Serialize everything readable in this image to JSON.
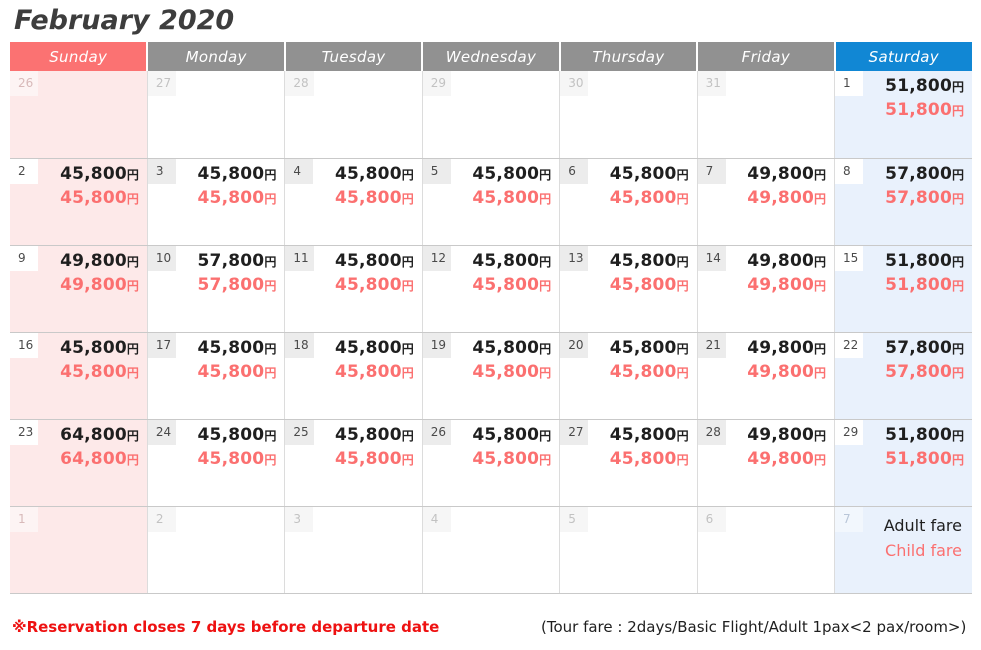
{
  "header": {
    "title": "February 2020"
  },
  "calendar": {
    "weekday_headers": [
      {
        "label": "Sunday",
        "kind": "sun"
      },
      {
        "label": "Monday",
        "kind": "weekday"
      },
      {
        "label": "Tuesday",
        "kind": "weekday"
      },
      {
        "label": "Wednesday",
        "kind": "weekday"
      },
      {
        "label": "Thursday",
        "kind": "weekday"
      },
      {
        "label": "Friday",
        "kind": "weekday"
      },
      {
        "label": "Saturday",
        "kind": "sat"
      }
    ],
    "currency_suffix": "円",
    "colors": {
      "sunday_header": "#fb7272",
      "weekday_header": "#919191",
      "saturday_header": "#1187d4",
      "sunday_cell": "#fde9e9",
      "saturday_cell": "#e9f1fc",
      "adult_fare_text": "#1f1f1f",
      "child_fare_text": "#fb7070",
      "note_text": "#ee1111"
    },
    "weeks": [
      [
        {
          "day": "26",
          "in_month": false,
          "col": "sun",
          "adult": "",
          "child": ""
        },
        {
          "day": "27",
          "in_month": false,
          "col": "weekday",
          "adult": "",
          "child": ""
        },
        {
          "day": "28",
          "in_month": false,
          "col": "weekday",
          "adult": "",
          "child": ""
        },
        {
          "day": "29",
          "in_month": false,
          "col": "weekday",
          "adult": "",
          "child": ""
        },
        {
          "day": "30",
          "in_month": false,
          "col": "weekday",
          "adult": "",
          "child": ""
        },
        {
          "day": "31",
          "in_month": false,
          "col": "weekday",
          "adult": "",
          "child": ""
        },
        {
          "day": "1",
          "in_month": true,
          "col": "sat",
          "adult": "51,800",
          "child": "51,800"
        }
      ],
      [
        {
          "day": "2",
          "in_month": true,
          "col": "sun",
          "adult": "45,800",
          "child": "45,800"
        },
        {
          "day": "3",
          "in_month": true,
          "col": "weekday",
          "adult": "45,800",
          "child": "45,800"
        },
        {
          "day": "4",
          "in_month": true,
          "col": "weekday",
          "adult": "45,800",
          "child": "45,800"
        },
        {
          "day": "5",
          "in_month": true,
          "col": "weekday",
          "adult": "45,800",
          "child": "45,800"
        },
        {
          "day": "6",
          "in_month": true,
          "col": "weekday",
          "adult": "45,800",
          "child": "45,800"
        },
        {
          "day": "7",
          "in_month": true,
          "col": "weekday",
          "adult": "49,800",
          "child": "49,800"
        },
        {
          "day": "8",
          "in_month": true,
          "col": "sat",
          "adult": "57,800",
          "child": "57,800"
        }
      ],
      [
        {
          "day": "9",
          "in_month": true,
          "col": "sun",
          "adult": "49,800",
          "child": "49,800"
        },
        {
          "day": "10",
          "in_month": true,
          "col": "weekday",
          "adult": "57,800",
          "child": "57,800"
        },
        {
          "day": "11",
          "in_month": true,
          "col": "weekday",
          "adult": "45,800",
          "child": "45,800"
        },
        {
          "day": "12",
          "in_month": true,
          "col": "weekday",
          "adult": "45,800",
          "child": "45,800"
        },
        {
          "day": "13",
          "in_month": true,
          "col": "weekday",
          "adult": "45,800",
          "child": "45,800"
        },
        {
          "day": "14",
          "in_month": true,
          "col": "weekday",
          "adult": "49,800",
          "child": "49,800"
        },
        {
          "day": "15",
          "in_month": true,
          "col": "sat",
          "adult": "51,800",
          "child": "51,800"
        }
      ],
      [
        {
          "day": "16",
          "in_month": true,
          "col": "sun",
          "adult": "45,800",
          "child": "45,800"
        },
        {
          "day": "17",
          "in_month": true,
          "col": "weekday",
          "adult": "45,800",
          "child": "45,800"
        },
        {
          "day": "18",
          "in_month": true,
          "col": "weekday",
          "adult": "45,800",
          "child": "45,800"
        },
        {
          "day": "19",
          "in_month": true,
          "col": "weekday",
          "adult": "45,800",
          "child": "45,800"
        },
        {
          "day": "20",
          "in_month": true,
          "col": "weekday",
          "adult": "45,800",
          "child": "45,800"
        },
        {
          "day": "21",
          "in_month": true,
          "col": "weekday",
          "adult": "49,800",
          "child": "49,800"
        },
        {
          "day": "22",
          "in_month": true,
          "col": "sat",
          "adult": "57,800",
          "child": "57,800"
        }
      ],
      [
        {
          "day": "23",
          "in_month": true,
          "col": "sun",
          "adult": "64,800",
          "child": "64,800"
        },
        {
          "day": "24",
          "in_month": true,
          "col": "weekday",
          "adult": "45,800",
          "child": "45,800"
        },
        {
          "day": "25",
          "in_month": true,
          "col": "weekday",
          "adult": "45,800",
          "child": "45,800"
        },
        {
          "day": "26",
          "in_month": true,
          "col": "weekday",
          "adult": "45,800",
          "child": "45,800"
        },
        {
          "day": "27",
          "in_month": true,
          "col": "weekday",
          "adult": "45,800",
          "child": "45,800"
        },
        {
          "day": "28",
          "in_month": true,
          "col": "weekday",
          "adult": "49,800",
          "child": "49,800"
        },
        {
          "day": "29",
          "in_month": true,
          "col": "sat",
          "adult": "51,800",
          "child": "51,800"
        }
      ],
      [
        {
          "day": "1",
          "in_month": false,
          "col": "sun",
          "adult": "",
          "child": ""
        },
        {
          "day": "2",
          "in_month": false,
          "col": "weekday",
          "adult": "",
          "child": ""
        },
        {
          "day": "3",
          "in_month": false,
          "col": "weekday",
          "adult": "",
          "child": ""
        },
        {
          "day": "4",
          "in_month": false,
          "col": "weekday",
          "adult": "",
          "child": ""
        },
        {
          "day": "5",
          "in_month": false,
          "col": "weekday",
          "adult": "",
          "child": ""
        },
        {
          "day": "6",
          "in_month": false,
          "col": "weekday",
          "adult": "",
          "child": ""
        },
        {
          "day": "7",
          "in_month": false,
          "col": "sat",
          "adult": "",
          "child": "",
          "legend": true
        }
      ]
    ],
    "legend": {
      "adult_label": "Adult fare",
      "child_label": "Child fare"
    }
  },
  "footer": {
    "note": "※Reservation closes 7 days before departure date",
    "fare_conditions": "(Tour fare : 2days/Basic Flight/Adult 1pax<2 pax/room>)"
  }
}
